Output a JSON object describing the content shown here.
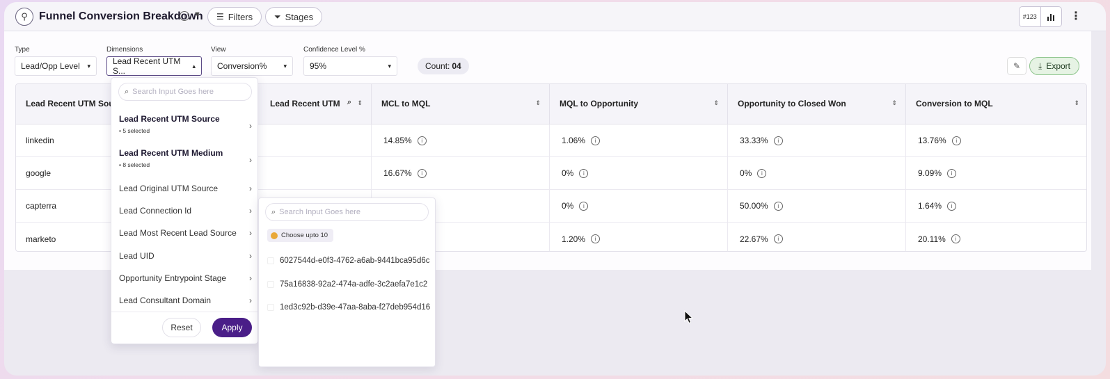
{
  "header": {
    "title": "Funnel Conversion Breakdown",
    "filters_label": "Filters",
    "stages_label": "Stages",
    "numeric_toggle": "#123"
  },
  "controls": {
    "type": {
      "label": "Type",
      "value": "Lead/Opp Level"
    },
    "dimensions": {
      "label": "Dimensions",
      "value": "Lead Recent UTM S..."
    },
    "view": {
      "label": "View",
      "value": "Conversion%"
    },
    "confidence": {
      "label": "Confidence Level %",
      "value": "95%"
    },
    "count_label": "Count:",
    "count_value": "04",
    "export_label": "Export"
  },
  "table": {
    "columns": [
      "Lead Recent UTM Sourc",
      "Lead Recent UTM Medium",
      "MCL to MQL",
      "MQL to Opportunity",
      "Opportunity to Closed Won",
      "Conversion to MQL"
    ],
    "rows": [
      {
        "source": "linkedin",
        "mcl_mql": "14.85%",
        "mql_opp": "1.06%",
        "opp_won": "33.33%",
        "conv_mql": "13.76%"
      },
      {
        "source": "google",
        "mcl_mql": "16.67%",
        "mql_opp": "0%",
        "opp_won": "0%",
        "conv_mql": "9.09%"
      },
      {
        "source": "capterra",
        "mcl_mql": "",
        "mql_opp": "0%",
        "opp_won": "50.00%",
        "conv_mql": "1.64%"
      },
      {
        "source": "marketo",
        "mcl_mql": "",
        "mql_opp": "1.20%",
        "opp_won": "22.67%",
        "conv_mql": "20.11%"
      }
    ]
  },
  "dimensions_panel": {
    "search_placeholder": "Search Input Goes here",
    "items": [
      {
        "label": "Lead Recent UTM Source",
        "sub": "• 5 selected"
      },
      {
        "label": "Lead Recent UTM Medium",
        "sub": "• 8 selected"
      },
      {
        "label": "Lead Original UTM Source"
      },
      {
        "label": "Lead Connection Id"
      },
      {
        "label": "Lead Most Recent Lead Source"
      },
      {
        "label": "Lead UID"
      },
      {
        "label": "Opportunity Entrypoint Stage"
      },
      {
        "label": "Lead Consultant Domain"
      }
    ],
    "reset_label": "Reset",
    "apply_label": "Apply"
  },
  "values_panel": {
    "search_placeholder": "Search Input Goes here",
    "chip_label": "Choose upto 10",
    "options": [
      "6027544d-e0f3-4762-a6ab-9441bca95d6c",
      "75a16838-92a2-474a-adfe-3c2aefa7e1c2",
      "1ed3c92b-d39e-47aa-8aba-f27deb954d16"
    ]
  },
  "colors": {
    "accent": "#4a1e88",
    "export_bg": "#e6f3e4",
    "chip_dot": "#e9a838"
  }
}
